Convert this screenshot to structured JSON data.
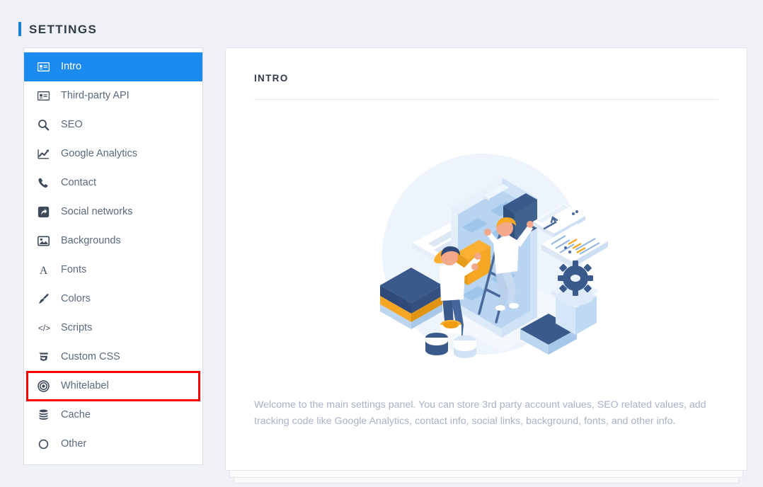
{
  "header": {
    "title": "SETTINGS"
  },
  "sidebar": {
    "items": [
      {
        "label": "Intro",
        "icon": "contact-card-icon",
        "active": true,
        "highlighted": false
      },
      {
        "label": "Third-party API",
        "icon": "contact-card-icon",
        "active": false,
        "highlighted": false
      },
      {
        "label": "SEO",
        "icon": "search-icon",
        "active": false,
        "highlighted": false
      },
      {
        "label": "Google Analytics",
        "icon": "chart-line-icon",
        "active": false,
        "highlighted": false
      },
      {
        "label": "Contact",
        "icon": "phone-icon",
        "active": false,
        "highlighted": false
      },
      {
        "label": "Social networks",
        "icon": "share-icon",
        "active": false,
        "highlighted": false
      },
      {
        "label": "Backgrounds",
        "icon": "image-icon",
        "active": false,
        "highlighted": false
      },
      {
        "label": "Fonts",
        "icon": "font-letter-a-icon",
        "active": false,
        "highlighted": false
      },
      {
        "label": "Colors",
        "icon": "paintbrush-icon",
        "active": false,
        "highlighted": false
      },
      {
        "label": "Scripts",
        "icon": "code-brackets-icon",
        "active": false,
        "highlighted": false
      },
      {
        "label": "Custom CSS",
        "icon": "css3-icon",
        "active": false,
        "highlighted": false
      },
      {
        "label": "Whitelabel",
        "icon": "bullseye-icon",
        "active": false,
        "highlighted": true
      },
      {
        "label": "Cache",
        "icon": "database-stack-icon",
        "active": false,
        "highlighted": false
      },
      {
        "label": "Other",
        "icon": "circle-icon",
        "active": false,
        "highlighted": false
      }
    ]
  },
  "main": {
    "section_title": "INTRO",
    "illustration": "app-building-isometric-illustration",
    "intro_text": "Welcome to the main settings panel. You can store 3rd party account values, SEO related values, add tracking code like Google Analytics, contact info, social links, background, fonts, and other info."
  },
  "colors": {
    "page_background": "#eff1f6",
    "accent_blue": "#1b7fd4",
    "active_item_blue": "#1c8bf0",
    "highlight_red": "#ff0000",
    "nav_text": "#5a6a7e",
    "title_text": "#2e3b49",
    "intro_text": "#a9b2c4",
    "panel_white": "#ffffff",
    "border_gray": "#d9dde5"
  }
}
